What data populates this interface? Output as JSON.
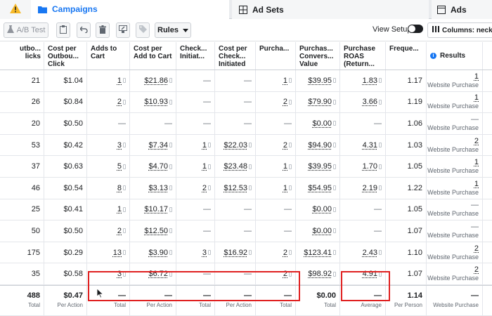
{
  "tabs": {
    "campaigns": "Campaigns",
    "adsets": "Ad Sets",
    "ads": "Ads"
  },
  "toolbar": {
    "ab_test": "A/B Test",
    "rules": "Rules",
    "view_setup": "View Setup",
    "columns": "Columns: necklac"
  },
  "headers": {
    "outbound": "utbo... licks",
    "cpc": "Cost per Outbou... Click",
    "atc": "Adds to Cart",
    "cpatc": "Cost per Add to Cart",
    "checkout": "Check... Initiat...",
    "cpcheckout": "Cost per Check... Initiated",
    "purch": "Purcha...",
    "pcv": "Purchas... Convers... Value",
    "roas": "Purchase ROAS (Return...",
    "freq": "Freque...",
    "results": "Results"
  },
  "rows": [
    {
      "outbound": "21",
      "cpc": "$1.04",
      "atc": "1",
      "cpatc": "$21.86",
      "checkout": "—",
      "cpcheckout": "—",
      "purch": "1",
      "pcv": "$39.95",
      "roas": "1.83",
      "freq": "1.17",
      "results": "1",
      "results_sub": "Website Purchase"
    },
    {
      "outbound": "26",
      "cpc": "$0.84",
      "atc": "2",
      "cpatc": "$10.93",
      "checkout": "—",
      "cpcheckout": "—",
      "purch": "2",
      "pcv": "$79.90",
      "roas": "3.66",
      "freq": "1.19",
      "results": "1",
      "results_sub": "Website Purchase"
    },
    {
      "outbound": "20",
      "cpc": "$0.50",
      "atc": "—",
      "cpatc": "—",
      "checkout": "—",
      "cpcheckout": "—",
      "purch": "—",
      "pcv": "$0.00",
      "roas": "—",
      "freq": "1.06",
      "results": "—",
      "results_sub": "Website Purchase"
    },
    {
      "outbound": "53",
      "cpc": "$0.42",
      "atc": "3",
      "cpatc": "$7.34",
      "checkout": "1",
      "cpcheckout": "$22.03",
      "purch": "2",
      "pcv": "$94.90",
      "roas": "4.31",
      "freq": "1.03",
      "results": "2",
      "results_sub": "Website Purchase"
    },
    {
      "outbound": "37",
      "cpc": "$0.63",
      "atc": "5",
      "cpatc": "$4.70",
      "checkout": "1",
      "cpcheckout": "$23.48",
      "purch": "1",
      "pcv": "$39.95",
      "roas": "1.70",
      "freq": "1.05",
      "results": "1",
      "results_sub": "Website Purchase"
    },
    {
      "outbound": "46",
      "cpc": "$0.54",
      "atc": "8",
      "cpatc": "$3.13",
      "checkout": "2",
      "cpcheckout": "$12.53",
      "purch": "1",
      "pcv": "$54.95",
      "roas": "2.19",
      "freq": "1.22",
      "results": "1",
      "results_sub": "Website Purchase"
    },
    {
      "outbound": "25",
      "cpc": "$0.41",
      "atc": "1",
      "cpatc": "$10.17",
      "checkout": "—",
      "cpcheckout": "—",
      "purch": "—",
      "pcv": "$0.00",
      "roas": "—",
      "freq": "1.05",
      "results": "—",
      "results_sub": "Website Purchase"
    },
    {
      "outbound": "50",
      "cpc": "$0.50",
      "atc": "2",
      "cpatc": "$12.50",
      "checkout": "—",
      "cpcheckout": "—",
      "purch": "—",
      "pcv": "$0.00",
      "roas": "—",
      "freq": "1.07",
      "results": "—",
      "results_sub": "Website Purchase"
    },
    {
      "outbound": "175",
      "cpc": "$0.29",
      "atc": "13",
      "cpatc": "$3.90",
      "checkout": "3",
      "cpcheckout": "$16.92",
      "purch": "2",
      "pcv": "$123.41",
      "roas": "2.43",
      "freq": "1.10",
      "results": "2",
      "results_sub": "Website Purchase"
    },
    {
      "outbound": "35",
      "cpc": "$0.58",
      "atc": "3",
      "cpatc": "$6.72",
      "checkout": "—",
      "cpcheckout": "—",
      "purch": "2",
      "pcv": "$98.92",
      "roas": "4.91",
      "freq": "1.07",
      "results": "2",
      "results_sub": "Website Purchase"
    }
  ],
  "totals": {
    "outbound": {
      "value": "488",
      "label": "Total"
    },
    "cpc": {
      "value": "$0.47",
      "label": "Per Action"
    },
    "atc": {
      "value": "—",
      "label": "Total"
    },
    "cpatc": {
      "value": "—",
      "label": "Per Action"
    },
    "checkout": {
      "value": "—",
      "label": "Total"
    },
    "cpcheckout": {
      "value": "—",
      "label": "Per Action"
    },
    "purch": {
      "value": "—",
      "label": "Total"
    },
    "pcv": {
      "value": "$0.00",
      "label": "Total"
    },
    "roas": {
      "value": "—",
      "label": "Average"
    },
    "freq": {
      "value": "1.14",
      "label": "Per Person"
    },
    "results": {
      "value": "—",
      "label": "Website Purchase"
    }
  },
  "colors": {
    "brand": "#1877f2",
    "highlight": "#e02020",
    "warning": "#f7b928"
  }
}
